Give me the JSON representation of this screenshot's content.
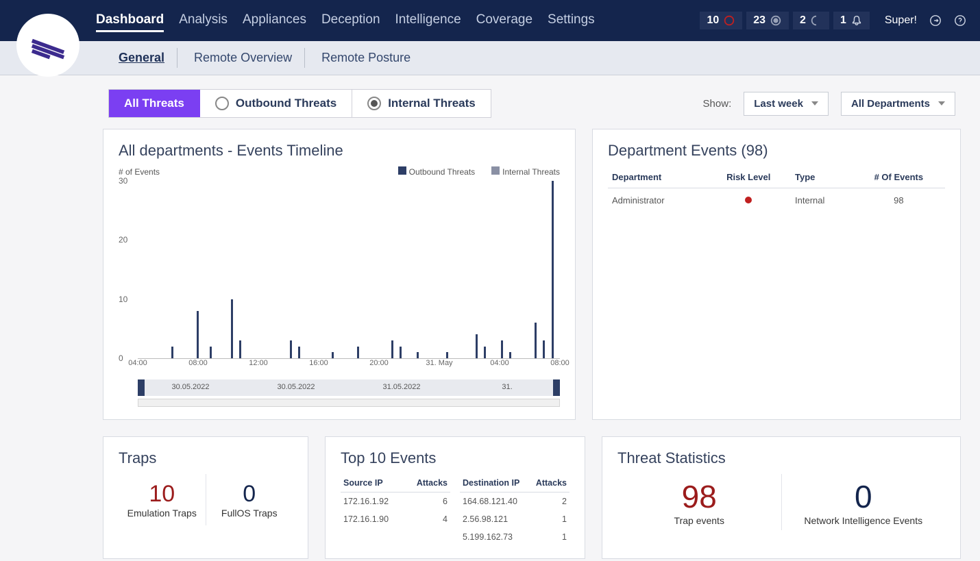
{
  "nav": {
    "items": [
      "Dashboard",
      "Analysis",
      "Appliances",
      "Deception",
      "Intelligence",
      "Coverage",
      "Settings"
    ],
    "active": 0
  },
  "status": {
    "pills": [
      {
        "value": "10",
        "icon": "ring-red"
      },
      {
        "value": "23",
        "icon": "ring-filled"
      },
      {
        "value": "2",
        "icon": "crescent"
      },
      {
        "value": "1",
        "icon": "bell"
      }
    ]
  },
  "user": {
    "name": "Super!"
  },
  "subnav": {
    "items": [
      "General",
      "Remote Overview",
      "Remote Posture"
    ],
    "active": 0
  },
  "threat_tabs": {
    "all": "All Threats",
    "outbound": "Outbound Threats",
    "internal": "Internal Threats"
  },
  "filter": {
    "show_label": "Show:",
    "time_range": "Last week",
    "department": "All Departments"
  },
  "timeline": {
    "title": "All departments - Events Timeline",
    "ylabel": "# of Events",
    "legend": {
      "outbound": "Outbound Threats",
      "internal": "Internal Threats"
    }
  },
  "chart_data": {
    "type": "bar",
    "title": "All departments - Events Timeline",
    "ylabel": "# of Events",
    "ylim": [
      0,
      30
    ],
    "yticks": [
      0,
      10,
      20,
      30
    ],
    "x_ticks": [
      "04:00",
      "08:00",
      "12:00",
      "16:00",
      "20:00",
      "31. May",
      "04:00",
      "08:00"
    ],
    "scrub_labels": [
      "30.05.2022",
      "30.05.2022",
      "31.05.2022",
      "31."
    ],
    "series": [
      {
        "name": "Outbound Threats",
        "color": "#2d3e66",
        "bars": [
          {
            "x_pct": 8,
            "value": 2
          },
          {
            "x_pct": 14,
            "value": 8
          },
          {
            "x_pct": 17,
            "value": 2
          },
          {
            "x_pct": 22,
            "value": 10
          },
          {
            "x_pct": 24,
            "value": 3
          },
          {
            "x_pct": 36,
            "value": 3
          },
          {
            "x_pct": 38,
            "value": 2
          },
          {
            "x_pct": 46,
            "value": 1
          },
          {
            "x_pct": 52,
            "value": 2
          },
          {
            "x_pct": 60,
            "value": 3
          },
          {
            "x_pct": 62,
            "value": 2
          },
          {
            "x_pct": 66,
            "value": 1
          },
          {
            "x_pct": 73,
            "value": 1
          },
          {
            "x_pct": 80,
            "value": 4
          },
          {
            "x_pct": 82,
            "value": 2
          },
          {
            "x_pct": 86,
            "value": 3
          },
          {
            "x_pct": 88,
            "value": 1
          },
          {
            "x_pct": 94,
            "value": 6
          },
          {
            "x_pct": 96,
            "value": 3
          },
          {
            "x_pct": 98,
            "value": 32
          }
        ]
      }
    ]
  },
  "dept_events": {
    "title": "Department Events (98)",
    "columns": {
      "dept": "Department",
      "risk": "Risk Level",
      "type": "Type",
      "count": "# Of Events"
    },
    "rows": [
      {
        "dept": "Administrator",
        "risk": "red",
        "type": "Internal",
        "count": "98"
      }
    ]
  },
  "traps": {
    "title": "Traps",
    "emulation": {
      "value": "10",
      "label": "Emulation Traps"
    },
    "fullos": {
      "value": "0",
      "label": "FullOS Traps"
    }
  },
  "top_events": {
    "title": "Top 10 Events",
    "cols": {
      "src": "Source IP",
      "dst": "Destination IP",
      "attacks": "Attacks"
    },
    "src_rows": [
      {
        "ip": "172.16.1.92",
        "attacks": "6"
      },
      {
        "ip": "172.16.1.90",
        "attacks": "4"
      }
    ],
    "dst_rows": [
      {
        "ip": "164.68.121.40",
        "attacks": "2"
      },
      {
        "ip": "2.56.98.121",
        "attacks": "1"
      },
      {
        "ip": "5.199.162.73",
        "attacks": "1"
      }
    ]
  },
  "stats": {
    "title": "Threat Statistics",
    "trap": {
      "value": "98",
      "label": "Trap events"
    },
    "net": {
      "value": "0",
      "label": "Network Intelligence Events"
    }
  }
}
